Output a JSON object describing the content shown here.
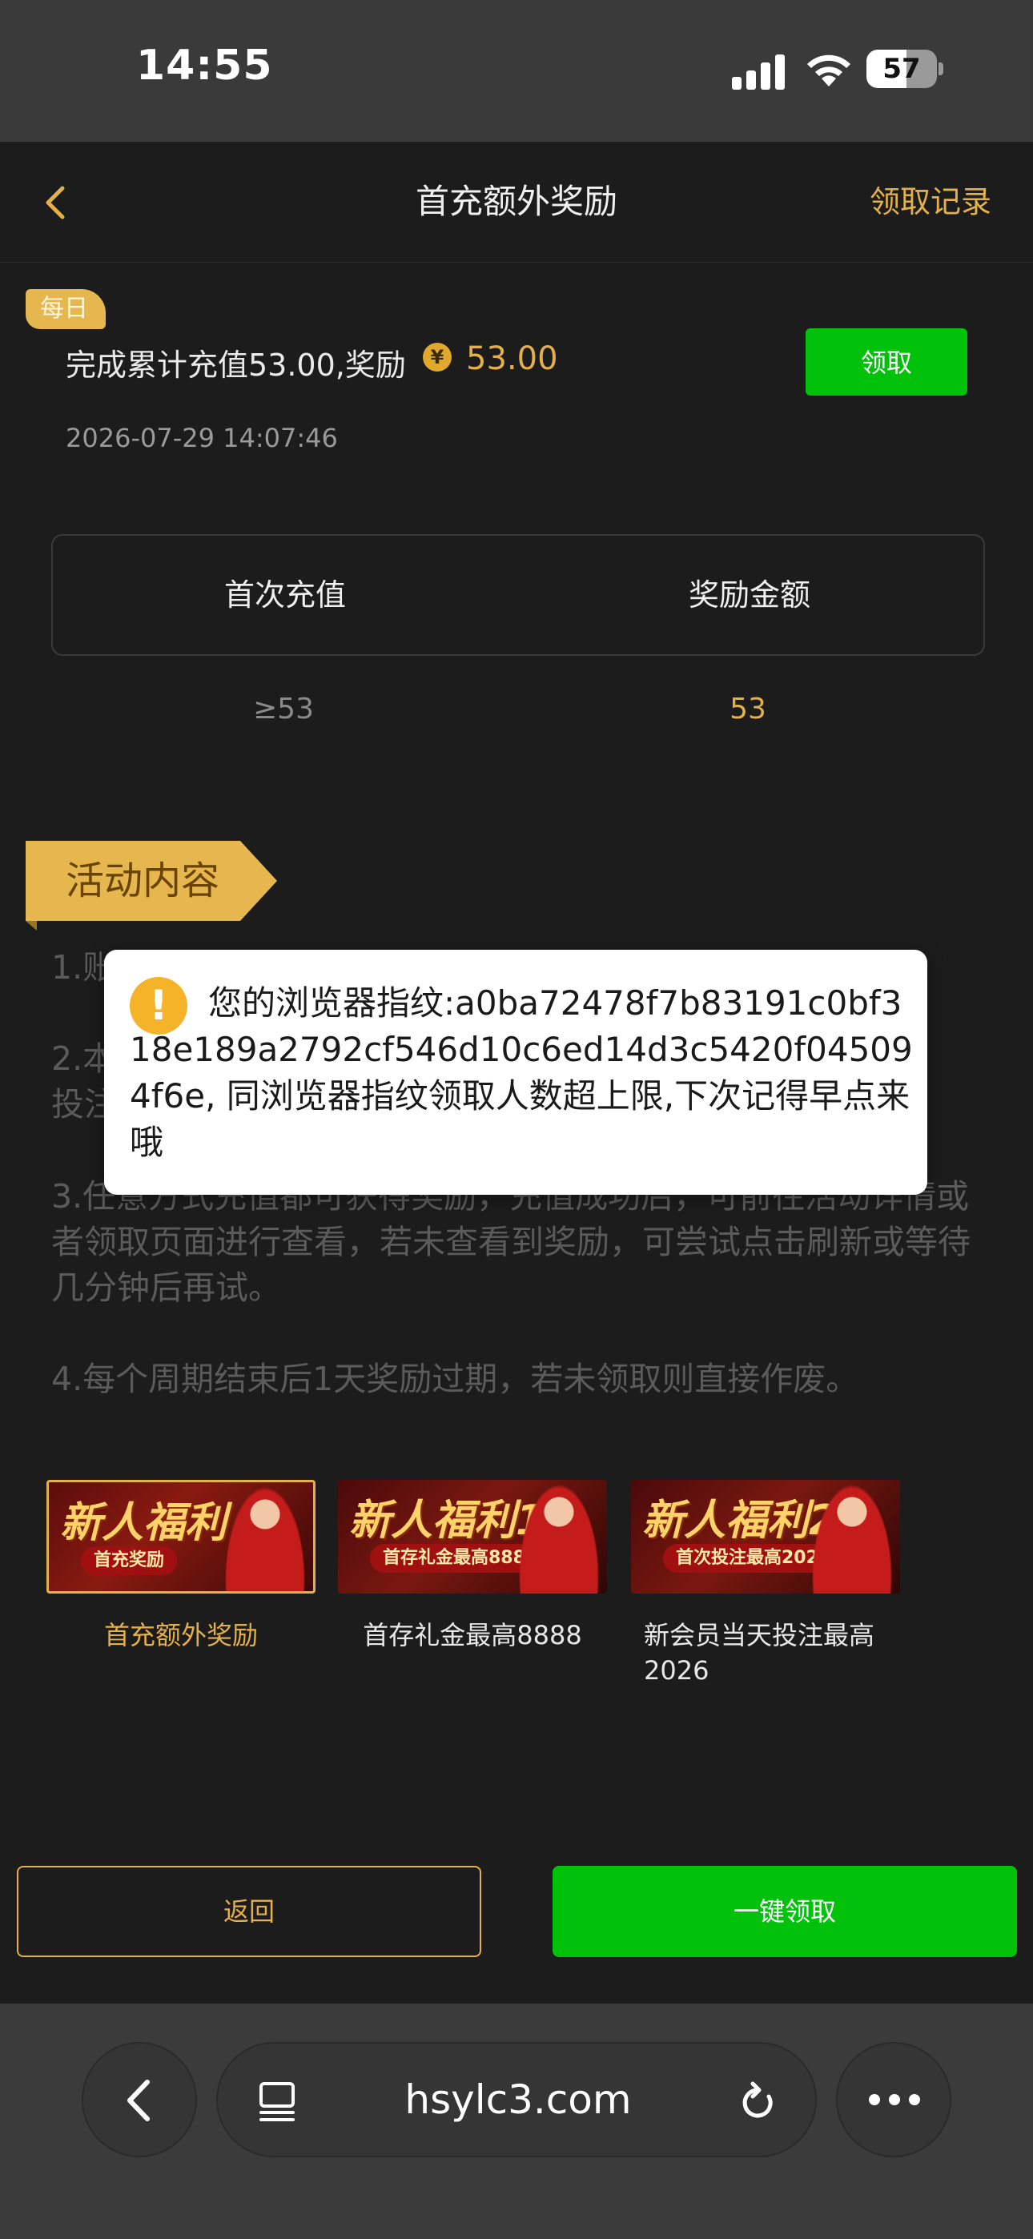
{
  "status_bar": {
    "time": "14:55",
    "battery_level": "57",
    "battery_fraction": 0.57
  },
  "header": {
    "title": "首充额外奖励",
    "records_link": "领取记录"
  },
  "daily_task": {
    "badge": "每日",
    "description": "完成累计充值53.00,奖励",
    "coin_symbol": "¥",
    "reward_amount": "53.00",
    "claim_label": "领取",
    "timestamp": "2026-07-29 14:07:46"
  },
  "reward_table": {
    "headers": [
      "首次充值",
      "奖励金额"
    ],
    "rows": [
      [
        "≥53",
        "53"
      ]
    ]
  },
  "activity": {
    "title": "活动内容",
    "rules": [
      "1.账",
      "2.本\n投注",
      "3.任意方式充值都可获得奖励，充值成功后，可前往活动详情或者领取页面进行查看，若未查看到奖励，可尝试点击刷新或等待几分钟后再试。",
      "4.每个周期结束后1天奖励过期，若未领取则直接作废。"
    ]
  },
  "toast": {
    "icon": "!",
    "message": "您的浏览器指纹:a0ba72478f7b83191c0bf318e189a2792cf546d10c6ed14d3c5420f045094f6e, 同浏览器指纹领取人数超上限,下次记得早点来哦"
  },
  "promos": [
    {
      "label": "首充额外奖励",
      "banner_title": "新人福利",
      "banner_sub": "首充奖励",
      "selected": true
    },
    {
      "label": "首存礼金最高8888",
      "banner_title": "新人福利1",
      "banner_sub": "首存礼金最高8888",
      "selected": false
    },
    {
      "label": "新会员当天投注最高2026",
      "banner_title": "新人福利2",
      "banner_sub": "首次投注最高2026",
      "selected": false
    }
  ],
  "buttons": {
    "back": "返回",
    "claim_all": "一键领取"
  },
  "browser": {
    "url": "hsylc3.com"
  },
  "colors": {
    "gold": "#e3b04b",
    "green": "#00c20a",
    "background": "#1c1c1c",
    "warning": "#f5b32a"
  },
  "icons": [
    "signal-icon",
    "wifi-icon",
    "battery-icon",
    "back-icon",
    "coin-icon",
    "warning-icon",
    "browser-back-icon",
    "tab-icon",
    "reload-icon",
    "more-icon"
  ]
}
